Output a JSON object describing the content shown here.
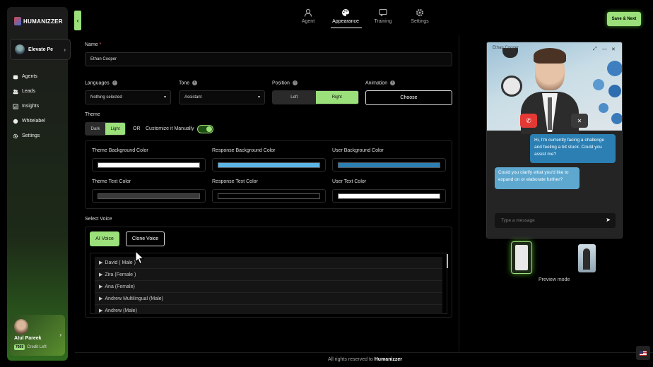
{
  "brand": {
    "name": "HUMANIZZER"
  },
  "workspace": {
    "name": "Elevate Pe"
  },
  "sidebar": {
    "items": [
      {
        "label": "Agents",
        "icon": "robot-icon"
      },
      {
        "label": "Leads",
        "icon": "users-icon"
      },
      {
        "label": "Insights",
        "icon": "chart-icon"
      },
      {
        "label": "Whitelabel",
        "icon": "circle-icon"
      },
      {
        "label": "Settings",
        "icon": "gear-icon"
      }
    ]
  },
  "user": {
    "name": "Atul Pareek",
    "credits": "7669",
    "credit_label": "Credit Left"
  },
  "tabs": [
    {
      "label": "Agent",
      "icon": "person-icon",
      "active": false
    },
    {
      "label": "Appearance",
      "icon": "palette-icon",
      "active": true
    },
    {
      "label": "Training",
      "icon": "training-icon",
      "active": false
    },
    {
      "label": "Settings",
      "icon": "gear-icon",
      "active": false
    }
  ],
  "toolbar": {
    "save_label": "Save & Next"
  },
  "form": {
    "name_label": "Name",
    "name_required": "*",
    "name_value": "Ethan Cooper",
    "languages_label": "Languages",
    "languages_value": "Nothing selected",
    "tone_label": "Tone",
    "tone_value": "Assistant",
    "position_label": "Position",
    "position_options": [
      "Left",
      "Right"
    ],
    "position_selected": "Right",
    "animation_label": "Animation",
    "animation_button": "Choose",
    "theme_label": "Theme",
    "theme_options": [
      "Dark",
      "Light"
    ],
    "theme_selected": "Light",
    "or_label": "OR",
    "customize_label": "Customize it Manually",
    "customize_on": true,
    "colors": [
      {
        "label": "Theme Background Color",
        "value": "#ffffff"
      },
      {
        "label": "Response Background Color",
        "value": "#5bb6e6"
      },
      {
        "label": "User Background Color",
        "value": "#2b7fb3"
      },
      {
        "label": "Theme Text Color",
        "value": "#3a3a3a"
      },
      {
        "label": "Response Text Color",
        "value": "#000000"
      },
      {
        "label": "User Text Color",
        "value": "#ffffff"
      }
    ],
    "voice_label": "Select Voice",
    "voice_buttons": [
      "AI Voice",
      "Clone Voice"
    ],
    "voice_selected": "AI Voice",
    "voices": [
      "David ( Male )",
      "Zira (Female )",
      "Ana (Female)",
      "Andrew Multilingual (Male)",
      "Andrew (Male)"
    ]
  },
  "preview": {
    "agent_name": "Ethan Cooper",
    "user_message": "Hi, I'm currently facing a challenge and feeling a bit stuck. Could you assist me?",
    "bot_message": "Could you clarify what you'd like to expand on or elaborate further?",
    "input_placeholder": "Type a message",
    "mode_label": "Preview mode"
  },
  "footer": {
    "prefix": "All rights reserved to ",
    "brand": "Humanizzer"
  },
  "colors": {
    "accent": "#9be07a",
    "danger": "#e53935"
  }
}
